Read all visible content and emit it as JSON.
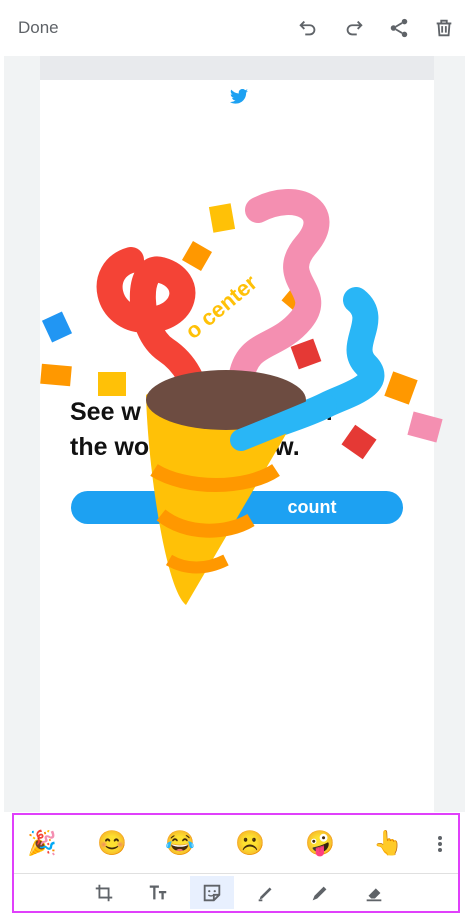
{
  "toolbar": {
    "done_label": "Done",
    "icons": [
      "undo-icon",
      "redo-icon",
      "share-icon",
      "delete-icon"
    ]
  },
  "screenshot": {
    "headline": "See w                  ing in\nthe wo                  w.",
    "cta_label": "count",
    "sticker_overlay_text": "o center"
  },
  "stickers": [
    "🎉",
    "😊",
    "😂",
    "☹️",
    "🤪",
    "👆"
  ],
  "tools": [
    "crop-icon",
    "text-icon",
    "sticker-icon",
    "pen-icon",
    "marker-icon",
    "highlighter-icon"
  ],
  "colors": {
    "accent_selection": "#e040fb",
    "twitter_blue": "#1da1f2",
    "active_tool_bg": "#e8f0fe"
  }
}
